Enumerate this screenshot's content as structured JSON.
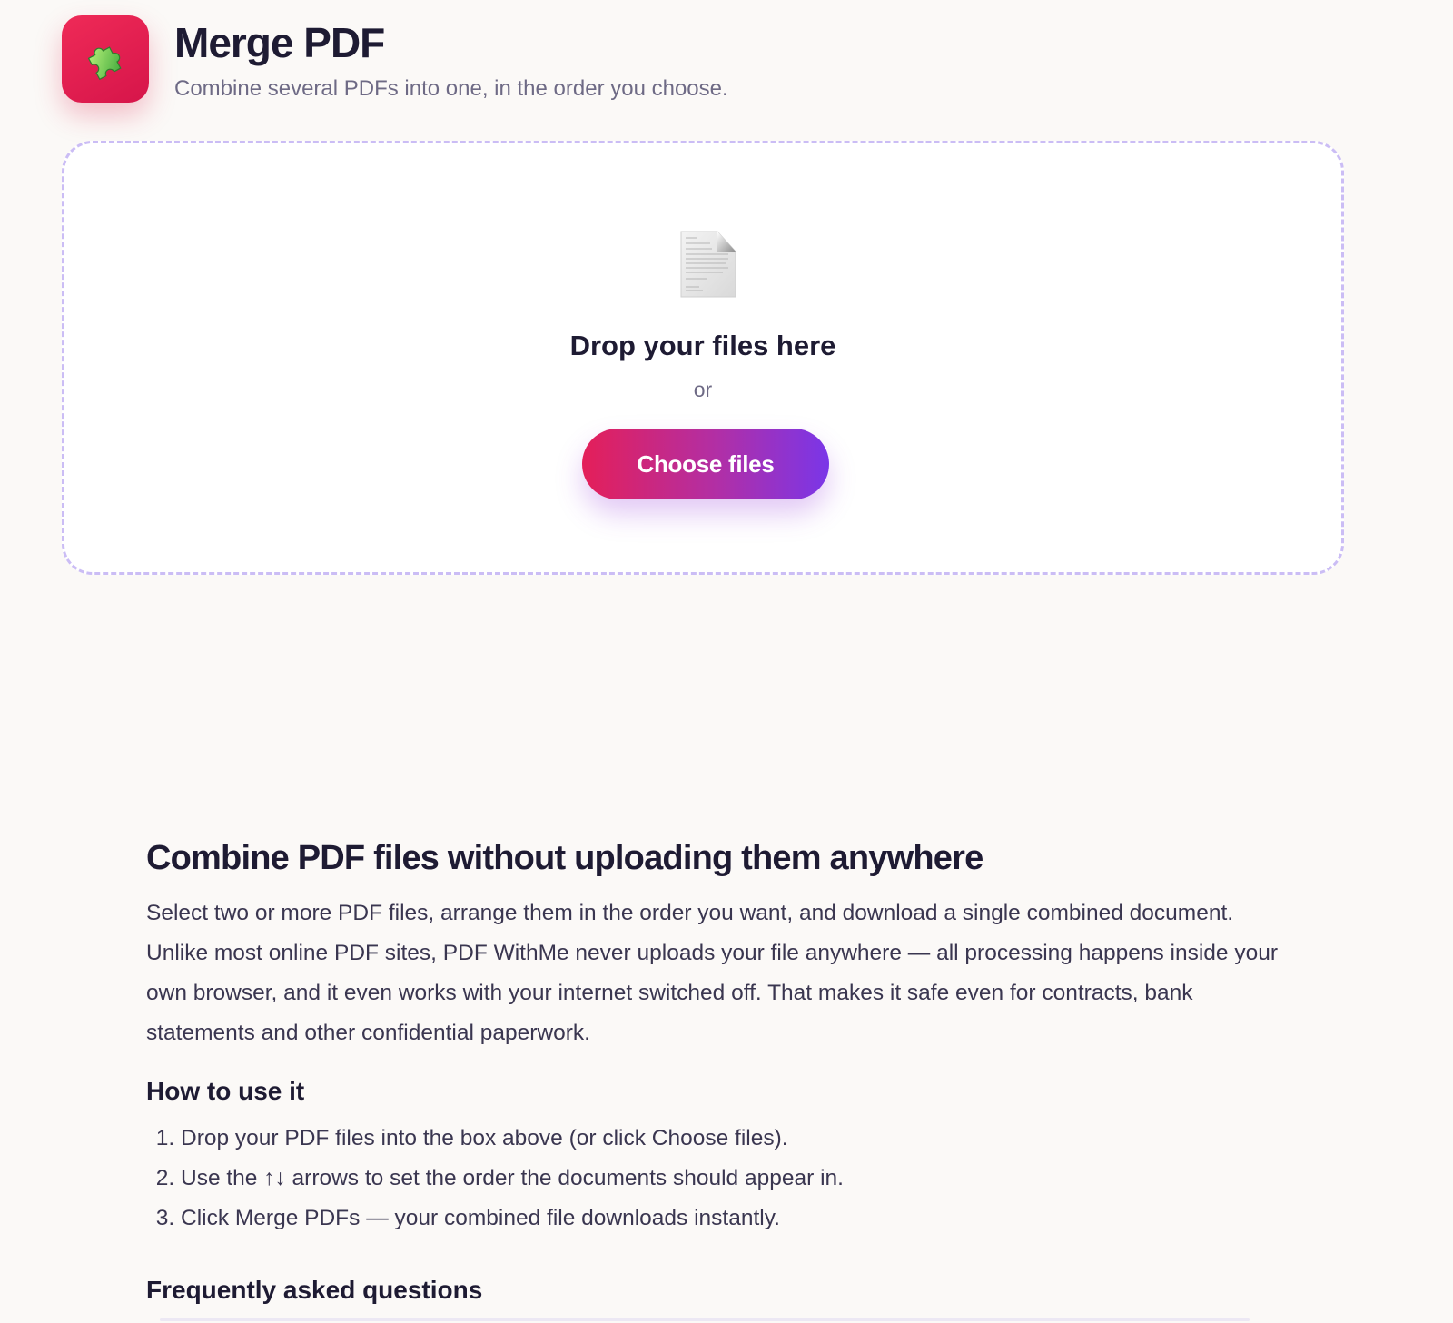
{
  "header": {
    "icon": "puzzle-piece-icon",
    "title": "Merge PDF",
    "subtitle": "Combine several PDFs into one, in the order you choose."
  },
  "dropzone": {
    "icon": "document-icon",
    "title": "Drop your files here",
    "or": "or",
    "button": "Choose files"
  },
  "content": {
    "heading": "Combine PDF files without uploading them anywhere",
    "lead": "Select two or more PDF files, arrange them in the order you want, and download a single combined document. Unlike most online PDF sites, PDF WithMe never uploads your file anywhere — all processing happens inside your own browser, and it even works with your internet switched off. That makes it safe even for contracts, bank statements and other confidential paperwork.",
    "howto_heading": "How to use it",
    "steps": [
      "Drop your PDF files into the box above (or click Choose files).",
      "Use the ↑↓ arrows to set the order the documents should appear in.",
      "Click Merge PDFs — your combined file downloads instantly."
    ],
    "faq_heading": "Frequently asked questions"
  },
  "colors": {
    "accent_red": "#e41f59",
    "accent_purple": "#7a36e8",
    "dropzone_border": "#cbbdf5",
    "page_bg": "#fbf9f7"
  }
}
